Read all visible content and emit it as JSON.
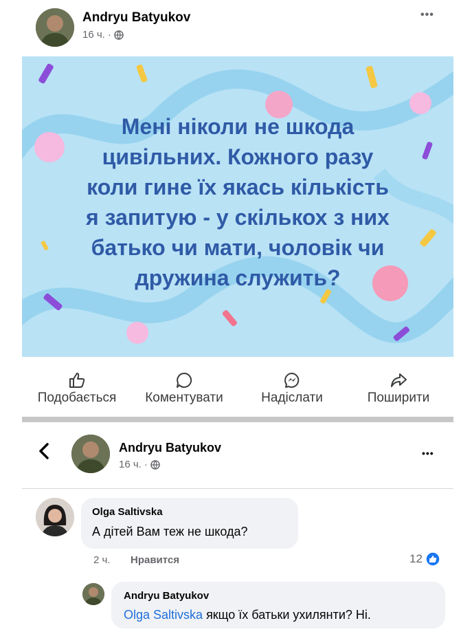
{
  "post": {
    "author": "Andryu Batyukov",
    "time": "16 ч.",
    "dot": "·",
    "more": "•••",
    "image_text_lines": [
      "Мені ніколи не шкода",
      "цивільних. Кожного разу",
      "коли гине їх якась кількість",
      "я запитую - у скількох з них",
      "батько чи мати, чоловік чи",
      "дружина служить?"
    ],
    "actions": [
      {
        "label": "Подобається",
        "icon": "like-icon"
      },
      {
        "label": "Коментувати",
        "icon": "comment-icon"
      },
      {
        "label": "Надіслати",
        "icon": "messenger-icon"
      },
      {
        "label": "Поширити",
        "icon": "share-icon"
      }
    ]
  },
  "detail": {
    "back": "‹",
    "author": "Andryu Batyukov",
    "time": "16 ч.",
    "dot": "·",
    "more": "•••"
  },
  "comments": [
    {
      "author": "Olga Saltivska",
      "text": "А дітей Вам теж не шкода?",
      "time": "2 ч.",
      "like_label": "Нравится",
      "reaction_count": "12"
    }
  ],
  "reply": {
    "author": "Andryu Batyukov",
    "mention": "Olga Saltivska",
    "text": " якщо їх батьки ухилянти? Ні."
  },
  "colors": {
    "card_bg": "#b9e2f5",
    "card_text": "#2f5aa6",
    "link": "#216fdb",
    "like_badge": "#1877f2"
  }
}
